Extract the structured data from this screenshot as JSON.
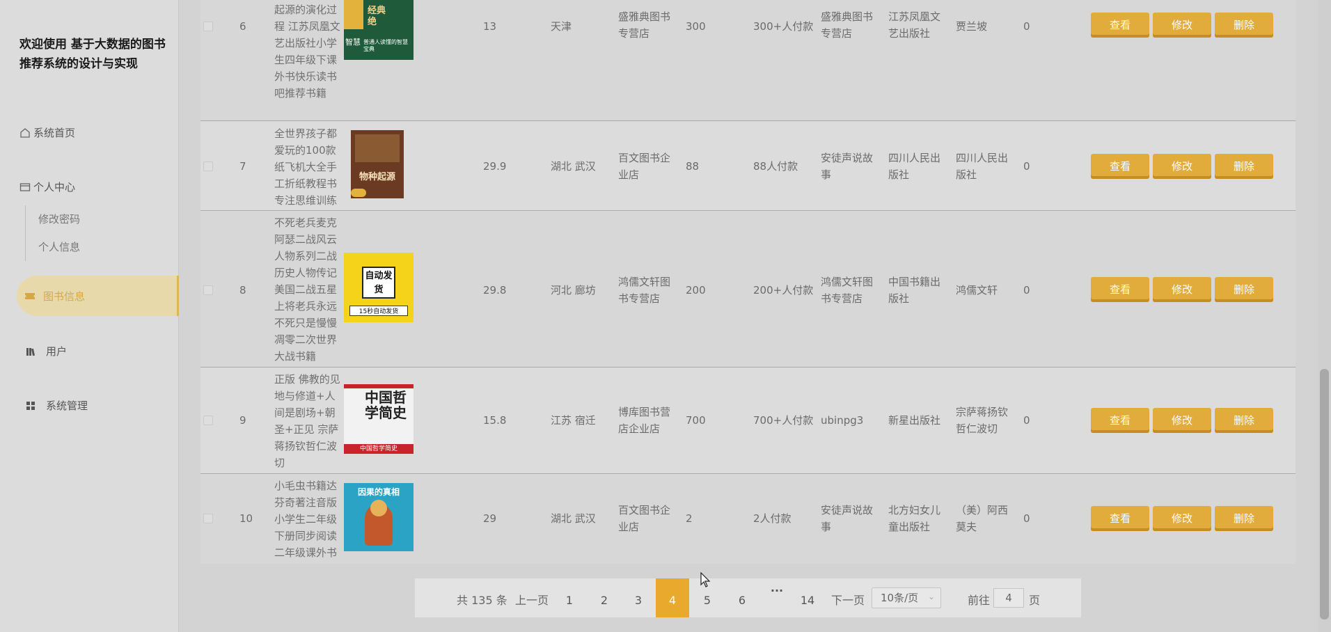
{
  "sidebar": {
    "title": "欢迎使用 基于大数据的图书推荐系统的设计与实现",
    "home": "系统首页",
    "personal_center": "个人中心",
    "change_password": "修改密码",
    "personal_info": "个人信息",
    "book_info": "图书信息",
    "users": "用户",
    "system_management": "系统管理"
  },
  "actions": {
    "view": "查看",
    "edit": "修改",
    "delete": "删除"
  },
  "rows": [
    {
      "index": "6",
      "title": "起源的演化过程 江苏凤凰文艺出版社小学生四年级下课外书快乐读书吧推荐书籍",
      "price": "13",
      "location": "天津",
      "shop": "盛雅典图书专营店",
      "sales": "300",
      "buyers": "300+人付款",
      "seller": "盛雅典图书专营店",
      "publisher": "江苏凤凰文艺出版社",
      "author": "贾兰坡",
      "count": "0",
      "cover_text_1": "经典",
      "cover_text_2": "智慧",
      "cover_text_3": "普通人读懂的智慧宝典"
    },
    {
      "index": "7",
      "title": "全世界孩子都爱玩的100款纸飞机大全手工折纸教程书专注思维训练",
      "price": "29.9",
      "location": "湖北 武汉",
      "shop": "百文图书企业店",
      "sales": "88",
      "buyers": "88人付款",
      "seller": "安徒声说故事",
      "publisher": "四川人民出版社",
      "author": "四川人民出版社",
      "count": "0",
      "cover_text_1": "物种起源"
    },
    {
      "index": "8",
      "title": "不死老兵麦克阿瑟二战风云人物系列二战历史人物传记美国二战五星上将老兵永远不死只是慢慢凋零二次世界大战书籍",
      "price": "29.8",
      "location": "河北 廊坊",
      "shop": "鸿儒文轩图书专营店",
      "sales": "200",
      "buyers": "200+人付款",
      "seller": "鸿儒文轩图书专营店",
      "publisher": "中国书籍出版社",
      "author": "鸿儒文轩",
      "count": "0",
      "cover_text_1": "自动发货",
      "cover_text_2": "15秒自动发货"
    },
    {
      "index": "9",
      "title": "正版 佛教的见地与修道+人间是剧场+朝圣+正见 宗萨蒋扬钦哲仁波切",
      "price": "15.8",
      "location": "江苏 宿迁",
      "shop": "博库图书营店企业店",
      "sales": "700",
      "buyers": "700+人付款",
      "seller": "ubinpg3",
      "publisher": "新星出版社",
      "author": "宗萨蒋扬钦哲仁波切",
      "count": "0",
      "cover_text_1": "中国哲学简史",
      "cover_text_2": "中国哲学简史"
    },
    {
      "index": "10",
      "title": "小毛虫书籍达芬奇著注音版小学生二年级下册同步阅读二年级课外书",
      "price": "29",
      "location": "湖北 武汉",
      "shop": "百文图书企业店",
      "sales": "2",
      "buyers": "2人付款",
      "seller": "安徒声说故事",
      "publisher": "北方妇女儿童出版社",
      "author": "（美）阿西莫夫",
      "count": "0",
      "cover_text_1": "因果的真相"
    }
  ],
  "pagination": {
    "total": "共 135 条",
    "prev": "上一页",
    "pages": [
      "1",
      "2",
      "3",
      "4",
      "5",
      "6"
    ],
    "active_page": "4",
    "ellipsis": "···",
    "last": "14",
    "next": "下一页",
    "page_size": "10条/页",
    "goto_label": "前往",
    "goto_value": "4",
    "goto_suffix": "页"
  },
  "colors": {
    "accent": "#e2ac3c",
    "sidebar_bg": "#dcdcdc",
    "active_nav_bg": "#e8d9ab",
    "active_nav_text": "#d6a845"
  }
}
